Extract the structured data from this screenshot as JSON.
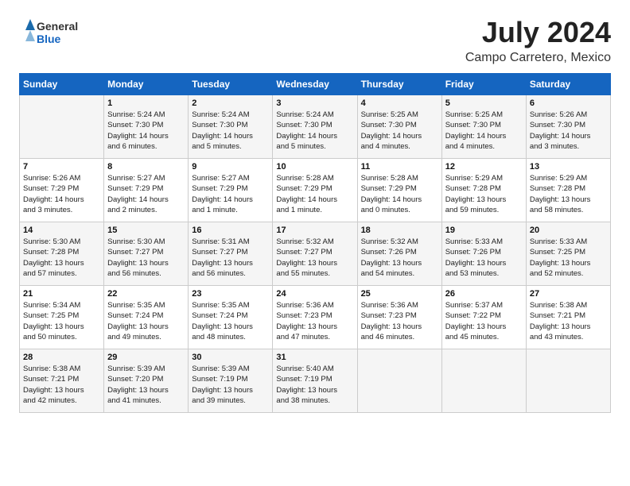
{
  "header": {
    "logo_general": "General",
    "logo_blue": "Blue",
    "month": "July 2024",
    "location": "Campo Carretero, Mexico"
  },
  "weekdays": [
    "Sunday",
    "Monday",
    "Tuesday",
    "Wednesday",
    "Thursday",
    "Friday",
    "Saturday"
  ],
  "weeks": [
    [
      {
        "day": "",
        "info": ""
      },
      {
        "day": "1",
        "info": "Sunrise: 5:24 AM\nSunset: 7:30 PM\nDaylight: 14 hours\nand 6 minutes."
      },
      {
        "day": "2",
        "info": "Sunrise: 5:24 AM\nSunset: 7:30 PM\nDaylight: 14 hours\nand 5 minutes."
      },
      {
        "day": "3",
        "info": "Sunrise: 5:24 AM\nSunset: 7:30 PM\nDaylight: 14 hours\nand 5 minutes."
      },
      {
        "day": "4",
        "info": "Sunrise: 5:25 AM\nSunset: 7:30 PM\nDaylight: 14 hours\nand 4 minutes."
      },
      {
        "day": "5",
        "info": "Sunrise: 5:25 AM\nSunset: 7:30 PM\nDaylight: 14 hours\nand 4 minutes."
      },
      {
        "day": "6",
        "info": "Sunrise: 5:26 AM\nSunset: 7:30 PM\nDaylight: 14 hours\nand 3 minutes."
      }
    ],
    [
      {
        "day": "7",
        "info": "Sunrise: 5:26 AM\nSunset: 7:29 PM\nDaylight: 14 hours\nand 3 minutes."
      },
      {
        "day": "8",
        "info": "Sunrise: 5:27 AM\nSunset: 7:29 PM\nDaylight: 14 hours\nand 2 minutes."
      },
      {
        "day": "9",
        "info": "Sunrise: 5:27 AM\nSunset: 7:29 PM\nDaylight: 14 hours\nand 1 minute."
      },
      {
        "day": "10",
        "info": "Sunrise: 5:28 AM\nSunset: 7:29 PM\nDaylight: 14 hours\nand 1 minute."
      },
      {
        "day": "11",
        "info": "Sunrise: 5:28 AM\nSunset: 7:29 PM\nDaylight: 14 hours\nand 0 minutes."
      },
      {
        "day": "12",
        "info": "Sunrise: 5:29 AM\nSunset: 7:28 PM\nDaylight: 13 hours\nand 59 minutes."
      },
      {
        "day": "13",
        "info": "Sunrise: 5:29 AM\nSunset: 7:28 PM\nDaylight: 13 hours\nand 58 minutes."
      }
    ],
    [
      {
        "day": "14",
        "info": "Sunrise: 5:30 AM\nSunset: 7:28 PM\nDaylight: 13 hours\nand 57 minutes."
      },
      {
        "day": "15",
        "info": "Sunrise: 5:30 AM\nSunset: 7:27 PM\nDaylight: 13 hours\nand 56 minutes."
      },
      {
        "day": "16",
        "info": "Sunrise: 5:31 AM\nSunset: 7:27 PM\nDaylight: 13 hours\nand 56 minutes."
      },
      {
        "day": "17",
        "info": "Sunrise: 5:32 AM\nSunset: 7:27 PM\nDaylight: 13 hours\nand 55 minutes."
      },
      {
        "day": "18",
        "info": "Sunrise: 5:32 AM\nSunset: 7:26 PM\nDaylight: 13 hours\nand 54 minutes."
      },
      {
        "day": "19",
        "info": "Sunrise: 5:33 AM\nSunset: 7:26 PM\nDaylight: 13 hours\nand 53 minutes."
      },
      {
        "day": "20",
        "info": "Sunrise: 5:33 AM\nSunset: 7:25 PM\nDaylight: 13 hours\nand 52 minutes."
      }
    ],
    [
      {
        "day": "21",
        "info": "Sunrise: 5:34 AM\nSunset: 7:25 PM\nDaylight: 13 hours\nand 50 minutes."
      },
      {
        "day": "22",
        "info": "Sunrise: 5:35 AM\nSunset: 7:24 PM\nDaylight: 13 hours\nand 49 minutes."
      },
      {
        "day": "23",
        "info": "Sunrise: 5:35 AM\nSunset: 7:24 PM\nDaylight: 13 hours\nand 48 minutes."
      },
      {
        "day": "24",
        "info": "Sunrise: 5:36 AM\nSunset: 7:23 PM\nDaylight: 13 hours\nand 47 minutes."
      },
      {
        "day": "25",
        "info": "Sunrise: 5:36 AM\nSunset: 7:23 PM\nDaylight: 13 hours\nand 46 minutes."
      },
      {
        "day": "26",
        "info": "Sunrise: 5:37 AM\nSunset: 7:22 PM\nDaylight: 13 hours\nand 45 minutes."
      },
      {
        "day": "27",
        "info": "Sunrise: 5:38 AM\nSunset: 7:21 PM\nDaylight: 13 hours\nand 43 minutes."
      }
    ],
    [
      {
        "day": "28",
        "info": "Sunrise: 5:38 AM\nSunset: 7:21 PM\nDaylight: 13 hours\nand 42 minutes."
      },
      {
        "day": "29",
        "info": "Sunrise: 5:39 AM\nSunset: 7:20 PM\nDaylight: 13 hours\nand 41 minutes."
      },
      {
        "day": "30",
        "info": "Sunrise: 5:39 AM\nSunset: 7:19 PM\nDaylight: 13 hours\nand 39 minutes."
      },
      {
        "day": "31",
        "info": "Sunrise: 5:40 AM\nSunset: 7:19 PM\nDaylight: 13 hours\nand 38 minutes."
      },
      {
        "day": "",
        "info": ""
      },
      {
        "day": "",
        "info": ""
      },
      {
        "day": "",
        "info": ""
      }
    ]
  ]
}
